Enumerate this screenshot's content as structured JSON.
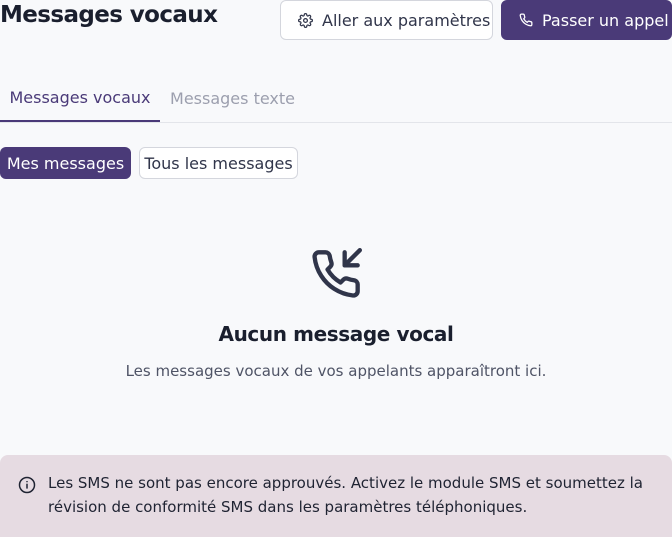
{
  "header": {
    "title": "Messages vocaux",
    "settings_button": "Aller aux paramètres",
    "call_button": "Passer un appel"
  },
  "tabs": [
    {
      "label": "Messages vocaux",
      "active": true
    },
    {
      "label": "Messages texte",
      "active": false
    }
  ],
  "filters": [
    {
      "label": "Mes messages",
      "active": true
    },
    {
      "label": "Tous les messages",
      "active": false
    }
  ],
  "empty_state": {
    "icon": "phone-incoming-icon",
    "title": "Aucun message vocal",
    "subtitle": "Les messages vocaux de vos appelants apparaîtront ici."
  },
  "notice": {
    "icon": "info-icon",
    "text": "Les SMS ne sont pas encore approuvés. Activez le module SMS et soumettez la révision de conformité SMS dans les paramètres téléphoniques."
  },
  "colors": {
    "brand": "#4a3a78",
    "background": "#f8f9fb",
    "notice_bg": "#e6dbe2",
    "muted_text": "#9c9fae"
  }
}
